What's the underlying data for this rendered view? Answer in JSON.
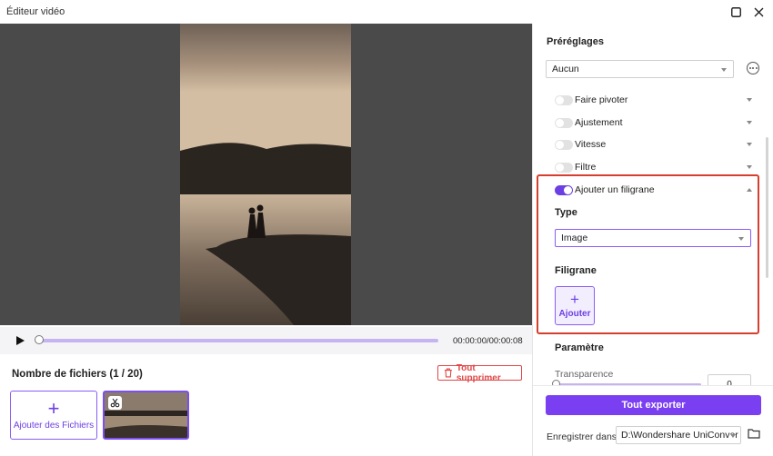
{
  "window": {
    "title": "Éditeur vidéo"
  },
  "player": {
    "timecode": "00:00:00/00:00:08",
    "progress": 0
  },
  "files": {
    "count_label": "Nombre de fichiers (1 / 20)",
    "delete_all_label": "Tout supprimer",
    "add_files_label": "Ajouter des Fichiers"
  },
  "presets": {
    "title": "Préréglages",
    "selected": "Aucun",
    "options": [
      {
        "label": "Faire pivoter",
        "enabled": false
      },
      {
        "label": "Ajustement",
        "enabled": false
      },
      {
        "label": "Vitesse",
        "enabled": false
      },
      {
        "label": "Filtre",
        "enabled": false
      }
    ]
  },
  "watermark": {
    "toggle_label": "Ajouter un filigrane",
    "enabled": true,
    "type_title": "Type",
    "type_value": "Image",
    "filigrane_title": "Filigrane",
    "add_label": "Ajouter",
    "add_symbol": "+"
  },
  "params": {
    "title": "Paramètre",
    "transparency_label": "Transparence",
    "transparency_value": "0"
  },
  "export": {
    "button_label": "Tout exporter",
    "save_label": "Enregistrer dans",
    "save_path": "D:\\Wondershare UniConver"
  },
  "colors": {
    "accent": "#7b3ff2",
    "highlight": "#d63e2e",
    "danger": "#e04848"
  }
}
